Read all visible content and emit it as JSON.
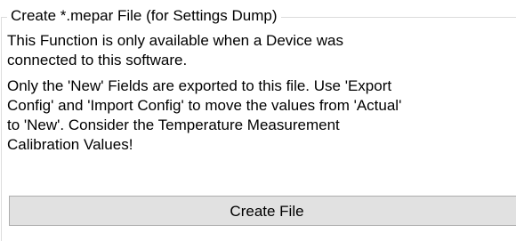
{
  "groupbox": {
    "title": "Create *.mepar File (for Settings Dump)",
    "info_line_1": "This Function is only available when a Device was",
    "info_line_2": "connected to this software.",
    "note_line_1": "Only the 'New' Fields are exported to this file. Use 'Export",
    "note_line_2": "Config' and 'Import Config' to move the values from 'Actual'",
    "note_line_3": "to 'New'. Consider the Temperature Measurement",
    "note_line_4": "Calibration Values!",
    "button_label": "Create File"
  },
  "colors": {
    "background": "#ffffff",
    "border": "#dcdcdc",
    "button_face": "#e1e1e1",
    "button_border": "#adadad"
  }
}
